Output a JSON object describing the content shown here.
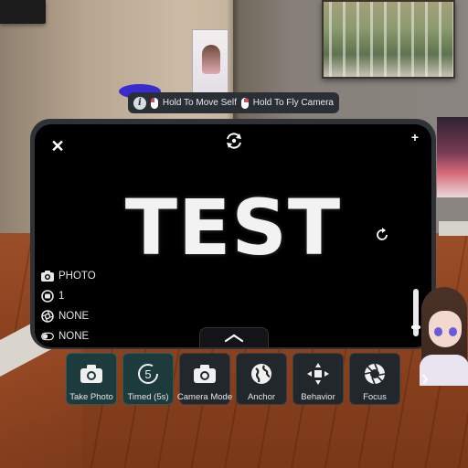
{
  "hint": {
    "move_self": "Hold To Move Self",
    "fly_camera": "Hold To Fly Camera"
  },
  "viewfinder": {
    "preview_text": "TEST"
  },
  "settings": [
    {
      "icon": "camera-icon",
      "label": "PHOTO"
    },
    {
      "icon": "timer-badge-icon",
      "label": "1"
    },
    {
      "icon": "aperture-icon",
      "label": "NONE"
    },
    {
      "icon": "toggle-icon",
      "label": "NONE"
    }
  ],
  "toolbar": [
    {
      "icon": "camera-icon",
      "label": "Take Photo",
      "selected": true
    },
    {
      "icon": "timer-5s-icon",
      "label": "Timed (5s)",
      "selected": true
    },
    {
      "icon": "camera-icon",
      "label": "Camera Mode",
      "selected": false
    },
    {
      "icon": "globe-icon",
      "label": "Anchor",
      "selected": false
    },
    {
      "icon": "move-arrows-icon",
      "label": "Behavior",
      "selected": false
    },
    {
      "icon": "aperture-icon",
      "label": "Focus",
      "selected": false
    }
  ],
  "timer_seconds": "5",
  "colors": {
    "panel": "#2f3338",
    "tool_button": "#22272c",
    "tool_button_selected": "#1d3a3c",
    "accent_red": "#e0465d"
  }
}
